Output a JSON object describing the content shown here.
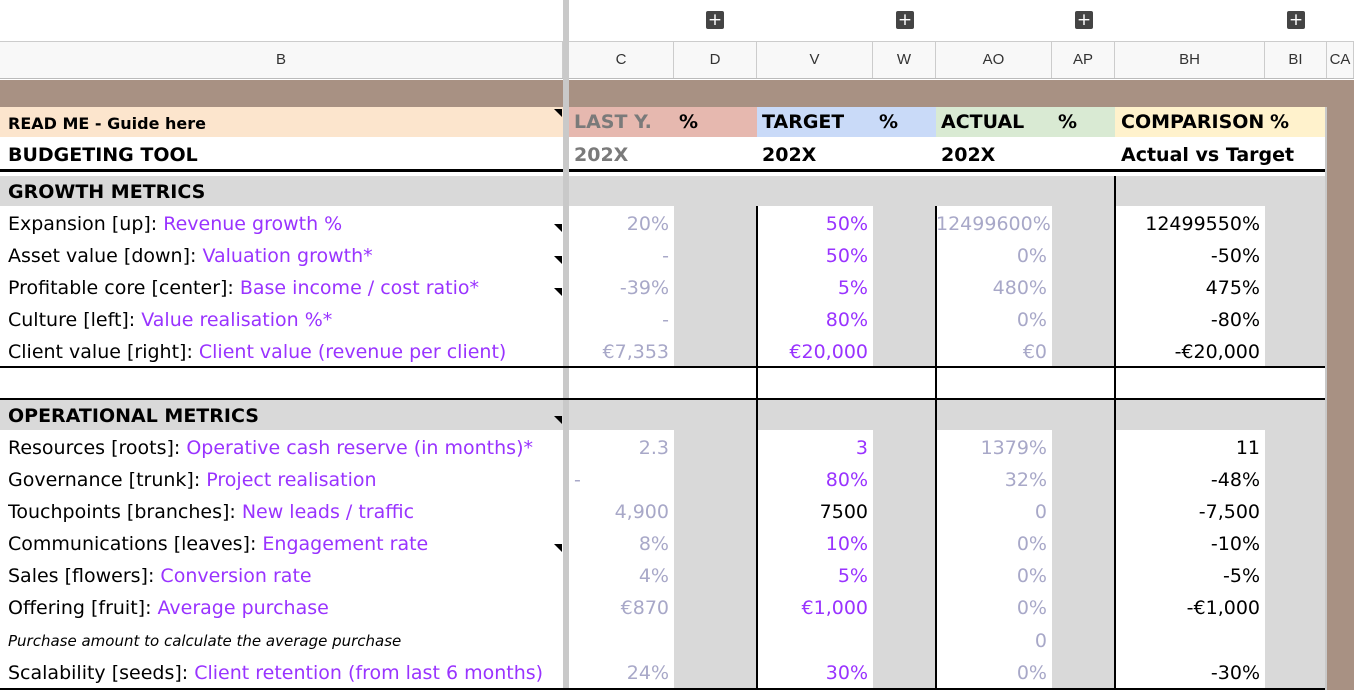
{
  "columns": [
    "B",
    "C",
    "D",
    "V",
    "W",
    "AO",
    "AP",
    "BH",
    "BI",
    "CA"
  ],
  "header": {
    "readme": "READ ME - Guide here",
    "tool": "BUDGETING TOOL",
    "last_y": "LAST Y.",
    "target": "TARGET",
    "actual": "ACTUAL",
    "comparison": "COMPARISON",
    "pct": "%",
    "year": "202X",
    "actual_vs_target": "Actual vs Target"
  },
  "sections": {
    "growth": "GROWTH METRICS",
    "operational": "OPERATIONAL METRICS"
  },
  "growth_rows": [
    {
      "label": "Expansion [up]: ",
      "metric": "Revenue growth %",
      "last": "20%",
      "target": "50%",
      "actual": "12499600%",
      "comp": "12499550%"
    },
    {
      "label": "Asset value [down]: ",
      "metric": "Valuation growth*",
      "last": "-",
      "target": "50%",
      "actual": "0%",
      "comp": "-50%"
    },
    {
      "label": "Profitable core [center]: ",
      "metric": "Base income / cost ratio*",
      "last": "-39%",
      "target": "5%",
      "actual": "480%",
      "comp": "475%"
    },
    {
      "label": "Culture [left]: ",
      "metric": "Value realisation %*",
      "last": "-",
      "target": "80%",
      "actual": "0%",
      "comp": "-80%"
    },
    {
      "label": "Client value [right]: ",
      "metric": "Client value (revenue per client)",
      "last": "€7,353",
      "target": "€20,000",
      "actual": "€0",
      "comp": "-€20,000"
    }
  ],
  "operational_rows": [
    {
      "label": "Resources [roots]: ",
      "metric": "Operative cash reserve (in months)*",
      "last": "2.3",
      "target": "3",
      "actual": "1379%",
      "comp": "11"
    },
    {
      "label": "Governance [trunk]: ",
      "metric": "Project realisation",
      "last": "-",
      "target": "80%",
      "actual": "32%",
      "comp": "-48%"
    },
    {
      "label": "Touchpoints [branches]: ",
      "metric": "New leads / traffic",
      "last": "4,900",
      "target": "7500",
      "actual": "0",
      "comp": "-7,500"
    },
    {
      "label": "Communications [leaves]: ",
      "metric": "Engagement rate",
      "last": "8%",
      "target": "10%",
      "actual": "0%",
      "comp": "-10%"
    },
    {
      "label": "Sales [flowers]: ",
      "metric": "Conversion rate",
      "last": "4%",
      "target": "5%",
      "actual": "0%",
      "comp": "-5%"
    },
    {
      "label": "Offering [fruit]: ",
      "metric": "Average purchase",
      "last": "€870",
      "target": "€1,000",
      "actual": "0%",
      "comp": "-€1,000"
    }
  ],
  "purchase_note": "Purchase amount to calculate the average purchase",
  "purchase_actual": "0",
  "scalability": {
    "label": "Scalability [seeds]: ",
    "metric": "Client retention (from last 6 months)",
    "last": "24%",
    "target": "30%",
    "actual": "0%",
    "comp": "-30%"
  },
  "colors": {
    "last_y": "#e6b8af",
    "target": "#c9daf8",
    "actual": "#d9ead3",
    "comparison": "#fff2cc",
    "readme": "#fce5cd",
    "brown": "#a89183",
    "gray": "#d9d9d9",
    "purple": "#9933ff",
    "muted": "#a8a8c8"
  }
}
